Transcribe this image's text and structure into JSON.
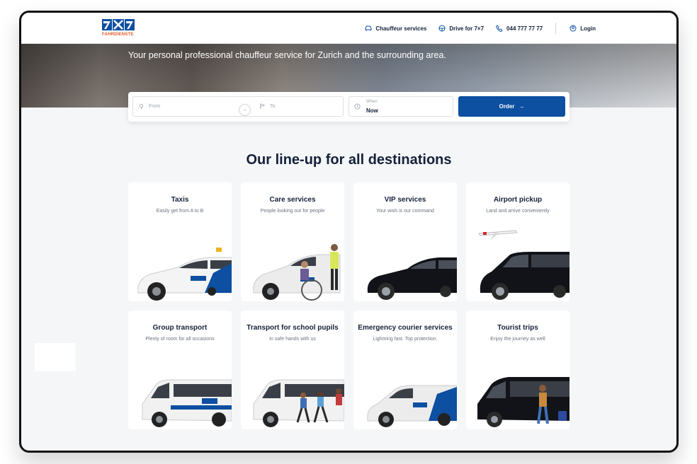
{
  "header": {
    "logo_text": "FAHRDIENSTE",
    "nav": [
      {
        "label": "Chauffeur services",
        "icon": "car-icon"
      },
      {
        "label": "Drive for 7×7",
        "icon": "steering-wheel-icon"
      },
      {
        "label": "044 777 77 77",
        "icon": "phone-icon"
      },
      {
        "label": "Login",
        "icon": "user-icon"
      }
    ]
  },
  "hero": {
    "tagline": "Your personal professional chauffeur service for Zurich and the surrounding area."
  },
  "search": {
    "from_placeholder": "From",
    "to_placeholder": "To",
    "when_label": "When",
    "when_value": "Now",
    "order_label": "Order",
    "order_arrow": "→"
  },
  "section": {
    "title": "Our line-up for all destinations"
  },
  "cards": [
    {
      "title": "Taxis",
      "subtitle": "Easily get from A to B"
    },
    {
      "title": "Care services",
      "subtitle": "People looking out for people"
    },
    {
      "title": "VIP services",
      "subtitle": "Your wish is our command"
    },
    {
      "title": "Airport pickup",
      "subtitle": "Land and arrive conveniently"
    },
    {
      "title": "Group transport",
      "subtitle": "Plenty of room for all occasions"
    },
    {
      "title": "Transport for school pupils",
      "subtitle": "In safe hands with us"
    },
    {
      "title": "Emergency courier services",
      "subtitle": "Lightning fast. Top protection."
    },
    {
      "title": "Tourist trips",
      "subtitle": "Enjoy the journey as well"
    }
  ],
  "colors": {
    "brand_blue": "#0d4fa0",
    "brand_orange": "#e3572a",
    "text_dark": "#15213a"
  }
}
